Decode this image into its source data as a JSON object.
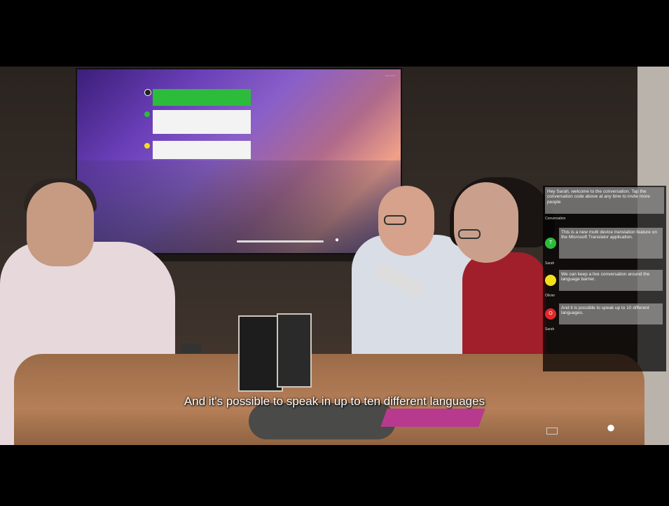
{
  "caption": "And it's possible to speak in up to ten different languages",
  "phone_app": {
    "intro": "Hey Sarah, welcome to the conversation. Tap the conversation code above at any time to invite more people",
    "section_label": "Conversation",
    "messages": [
      {
        "text": "This is a new multi device translation feature on the Microsoft Translator application.",
        "speaker": "Sarah",
        "color": "#2dbb3c"
      },
      {
        "text": "We can keep a live conversation around the language barrier.",
        "speaker": "Olivier",
        "color": "#f3df1a"
      },
      {
        "text": "And it is possible to speak up to 10 different languages.",
        "speaker": "Sarah",
        "color": "#e02a2a"
      }
    ]
  },
  "colors": {
    "tv_accent": "#6a3fb8",
    "green_bubble": "#2dbb3c",
    "caption_text": "#ffffff"
  },
  "icons": [
    "microphone-icon",
    "keyboard-icon"
  ]
}
